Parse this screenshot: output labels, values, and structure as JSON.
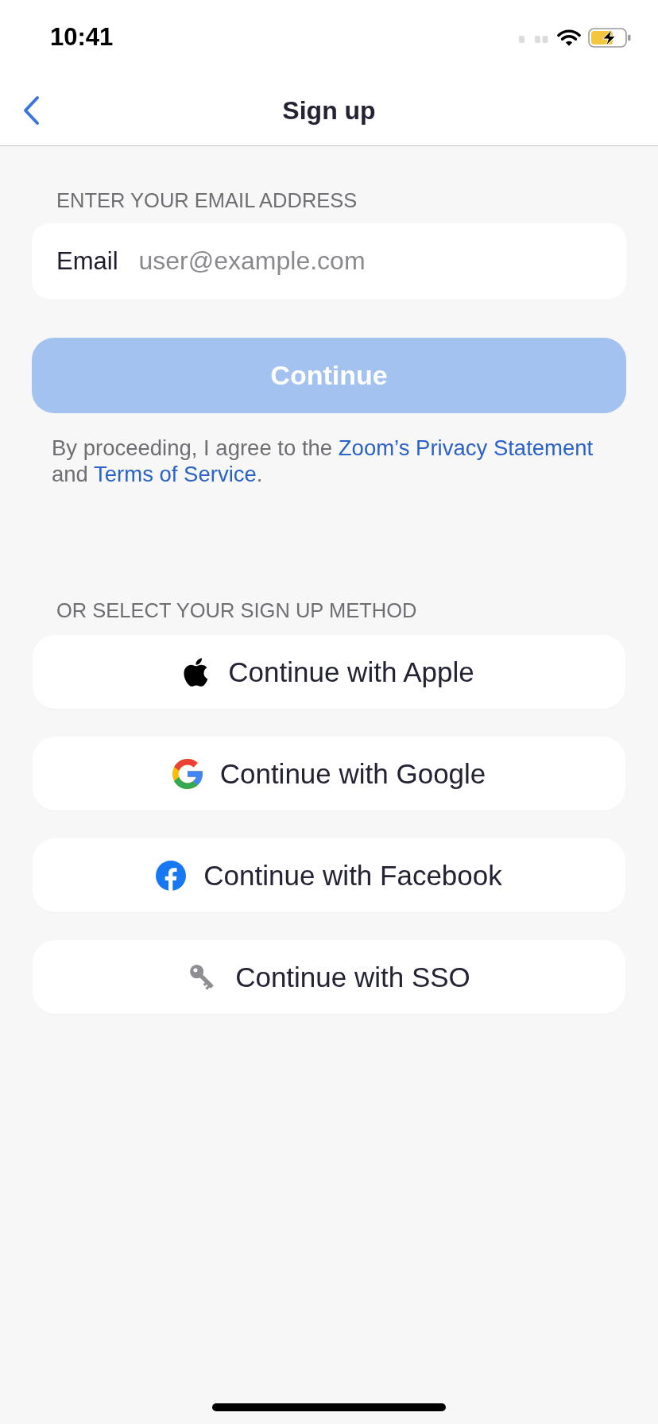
{
  "status_bar": {
    "time": "10:41"
  },
  "nav_bar": {
    "title": "Sign up"
  },
  "email_section": {
    "header": "ENTER YOUR EMAIL ADDRESS",
    "field": {
      "label": "Email",
      "placeholder": "user@example.com"
    },
    "continue_button": {
      "label": "Continue",
      "disabled": true
    },
    "disclaimer": [
      {
        "kind": "text",
        "text": "By proceeding, I agree to the "
      },
      {
        "kind": "link",
        "text": "Zoom’s Privacy Statement"
      },
      {
        "kind": "text",
        "text": " and "
      },
      {
        "kind": "link",
        "text": "Terms of Service"
      },
      {
        "kind": "text",
        "text": "."
      }
    ]
  },
  "sign_up_methods": {
    "header": "OR SELECT YOUR SIGN UP METHOD",
    "options": [
      {
        "kind": "apple",
        "label": "Continue with Apple"
      },
      {
        "kind": "google",
        "label": "Continue with Google"
      },
      {
        "kind": "facebook",
        "label": "Continue with Facebook"
      },
      {
        "kind": "sso",
        "label": "Continue with SSO"
      }
    ]
  }
}
